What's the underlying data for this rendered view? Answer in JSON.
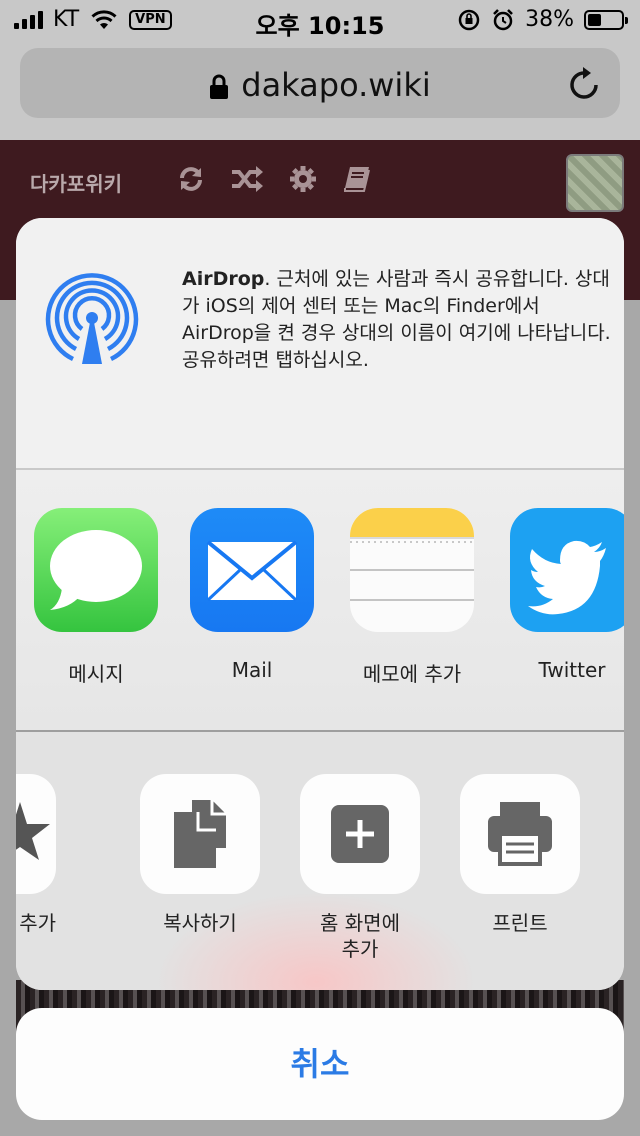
{
  "status_bar": {
    "carrier": "KT",
    "vpn": "VPN",
    "time": "오후 10:15",
    "battery": "38%",
    "battery_level": 0.38
  },
  "browser": {
    "url": "dakapo.wiki"
  },
  "site": {
    "title": "다카포위키"
  },
  "share_sheet": {
    "airdrop": {
      "title": "AirDrop",
      "description": ". 근처에 있는 사람과 즉시 공유합니다. 상대가 iOS의 제어 센터 또는 Mac의 Finder에서 AirDrop을 켠 경우 상대의 이름이 여기에 나타납니다. 공유하려면 탭하십시오."
    },
    "apps": [
      {
        "label": "메시지",
        "icon": "messages-icon"
      },
      {
        "label": "Mail",
        "icon": "mail-icon"
      },
      {
        "label": "메모에 추가",
        "icon": "notes-icon"
      },
      {
        "label": "Twitter",
        "icon": "twitter-icon"
      }
    ],
    "actions": [
      {
        "label": "찾기에 추가",
        "icon": "star-icon"
      },
      {
        "label": "복사하기",
        "icon": "copy-icon"
      },
      {
        "label_line1": "홈 화면에",
        "label_line2": "추가",
        "icon": "add-square-icon"
      },
      {
        "label": "프린트",
        "icon": "printer-icon"
      }
    ],
    "cancel": "취소"
  },
  "colors": {
    "accent": "#2b7be5",
    "site_header": "#3e1a1f",
    "airdrop_blue": "#2f7ef0"
  }
}
